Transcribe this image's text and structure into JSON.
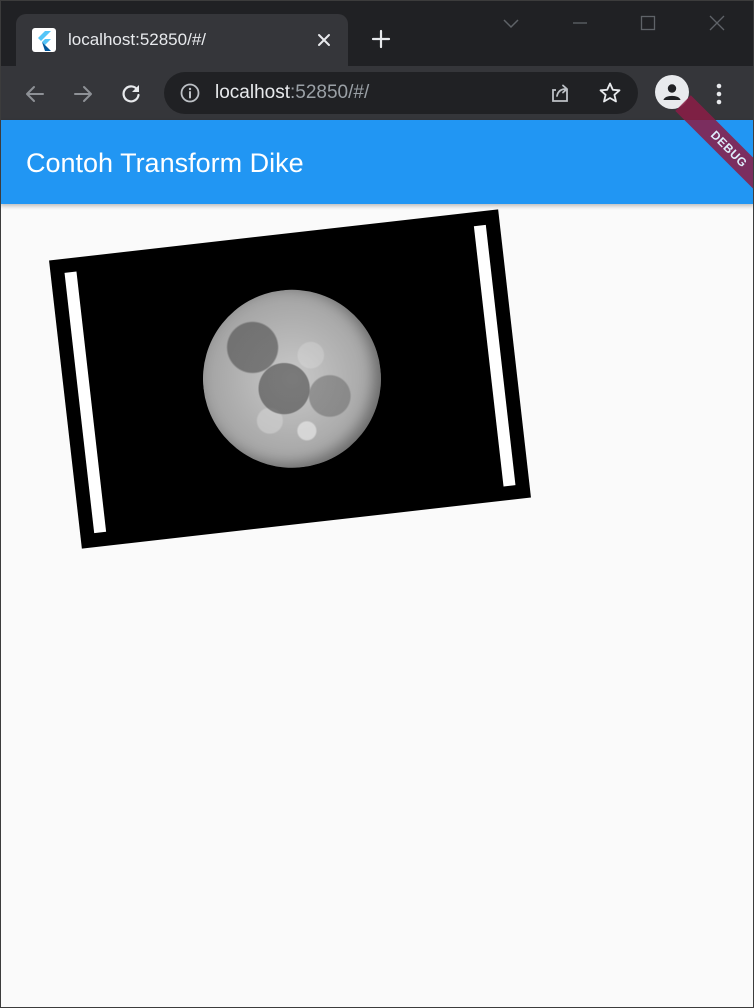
{
  "browser": {
    "tab": {
      "title": "localhost:52850/#/",
      "favicon": "flutter-logo-icon"
    },
    "new_tab_icon": "plus-icon",
    "window_controls": [
      "chevron-down-icon",
      "minimize-icon",
      "maximize-icon",
      "close-icon"
    ],
    "address_bar": {
      "host": "localhost",
      "path": ":52850/#/",
      "site_info_icon": "info-icon"
    },
    "nav_icons": [
      "back-arrow-icon",
      "forward-arrow-icon",
      "reload-icon"
    ],
    "address_actions": [
      "share-icon",
      "star-icon"
    ],
    "profile_icon": "profile-icon",
    "menu_icon": "kebab-menu-icon"
  },
  "app": {
    "title": "Contoh Transform Dike",
    "debug_banner": "DEBUG",
    "colors": {
      "appbar": "#2196f3",
      "debug_banner": "#8b1d46",
      "background": "#fafafa"
    },
    "image": {
      "subject": "full moon photograph",
      "transform": "rotated"
    }
  }
}
